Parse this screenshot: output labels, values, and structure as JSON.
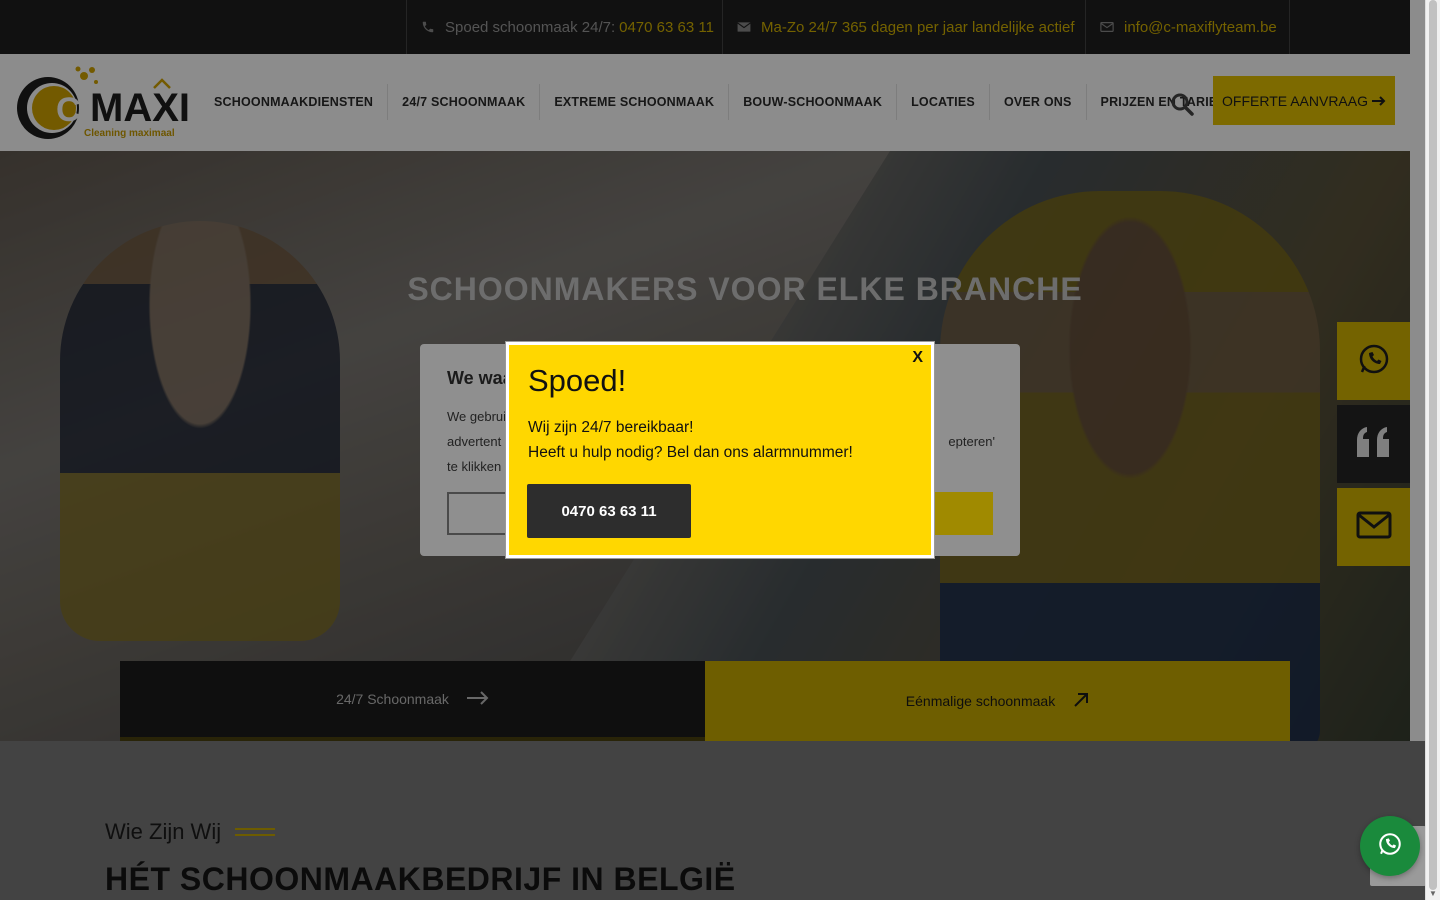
{
  "topbar": {
    "phone_label": "Spoed schoonmaak 24/7:",
    "phone_number": "0470 63 63 11",
    "hours": "Ma-Zo 24/7 365 dagen per jaar landelijke actief",
    "email": "info@c-maxiflyteam.be",
    "icons": [
      "phone-icon",
      "envelope-icon",
      "envelope-icon"
    ]
  },
  "logo": {
    "name": "MAXI",
    "prefix": "C-",
    "tagline": "Cleaning maximaal"
  },
  "nav": {
    "items": [
      "SCHOONMAAKDIENSTEN",
      "24/7 SCHOONMAAK",
      "EXTREME SCHOONMAAK",
      "BOUW-SCHOONMAAK",
      "LOCATIES",
      "OVER ONS",
      "PRIJZEN EN TARIEVEN"
    ],
    "cta": "OFFERTE AANVRAAG"
  },
  "hero": {
    "title": "SCHOONMAKERS VOOR ELKE BRANCHE",
    "tabs": [
      {
        "label": "24/7 Schoonmaak"
      },
      {
        "label": "Eénmalige schoonmaak"
      }
    ]
  },
  "side_buttons": [
    "whatsapp-icon",
    "quote-icon",
    "envelope-icon"
  ],
  "about": {
    "subtitle": "Wie Zijn Wij",
    "heading": "HÉT SCHOONMAAKBEDRIJF IN BELGIË"
  },
  "cookie": {
    "title_partial": "We waa",
    "line1": "We gebrui",
    "line2": "advertent",
    "line3": "te klikken",
    "line2_right": "epteren'"
  },
  "popup": {
    "close": "X",
    "title": "Spoed!",
    "line1": "Wij zijn 24/7 bereikbaar!",
    "line2": "Heeft u hulp nodig? Bel dan ons alarmnummer!",
    "button": "0470 63 63 11"
  },
  "colors": {
    "accent": "#d4b400",
    "popup_bg": "#ffd700",
    "dark": "#1f1f1f",
    "whatsapp": "#1a8a3c"
  }
}
